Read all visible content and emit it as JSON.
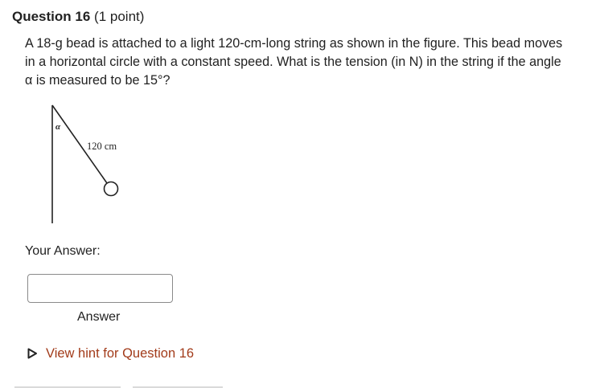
{
  "question": {
    "number_label": "Question 16",
    "points_label": "(1 point)",
    "text": "A 18-g bead is attached to a light 120-cm-long string as shown in the figure. This bead moves in a horizontal circle with a constant speed. What is the tension (in N) in the string if the angle α is measured to be 15°?"
  },
  "figure": {
    "angle_symbol": "α",
    "length_label": "120 cm"
  },
  "answer": {
    "prompt": "Your Answer:",
    "value": "",
    "label": "Answer"
  },
  "hint": {
    "link_text": "View hint for Question 16",
    "icon": "triangle-right-icon"
  },
  "colors": {
    "link": "#a23b1a",
    "text": "#222222"
  }
}
